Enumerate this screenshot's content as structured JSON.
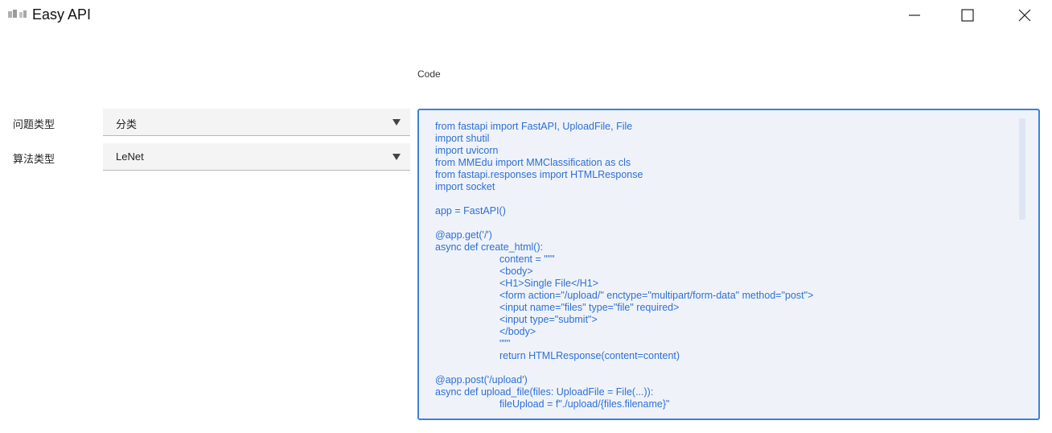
{
  "window": {
    "title": "Easy API",
    "icon": "app-logo-icon",
    "controls": [
      "minimize-icon",
      "maximize-icon",
      "close-icon"
    ]
  },
  "code_label": "Code",
  "form": {
    "problem_type": {
      "label": "问题类型",
      "value": "分类"
    },
    "algorithm_type": {
      "label": "算法类型",
      "value": "LeNet"
    }
  },
  "code": {
    "lines": [
      {
        "text": "from fastapi import FastAPI, UploadFile, File",
        "indent": false
      },
      {
        "text": "import shutil",
        "indent": false
      },
      {
        "text": "import uvicorn",
        "indent": false
      },
      {
        "text": "from MMEdu import MMClassification as cls",
        "indent": false
      },
      {
        "text": "from fastapi.responses import HTMLResponse",
        "indent": false
      },
      {
        "text": "import socket",
        "indent": false
      },
      {
        "text": "",
        "indent": false
      },
      {
        "text": "app = FastAPI()",
        "indent": false
      },
      {
        "text": "",
        "indent": false
      },
      {
        "text": "@app.get('/')",
        "indent": false
      },
      {
        "text": "async def create_html():",
        "indent": false
      },
      {
        "text": "content = \"\"\"",
        "indent": true
      },
      {
        "text": "<body>",
        "indent": true
      },
      {
        "text": "<H1>Single File</H1>",
        "indent": true
      },
      {
        "text": "<form action=\"/upload/\" enctype=\"multipart/form-data\" method=\"post\">",
        "indent": true
      },
      {
        "text": "<input name=\"files\" type=\"file\" required>",
        "indent": true
      },
      {
        "text": "<input type=\"submit\">",
        "indent": true
      },
      {
        "text": "</body>",
        "indent": true
      },
      {
        "text": "\"\"\"",
        "indent": true
      },
      {
        "text": "return HTMLResponse(content=content)",
        "indent": true
      },
      {
        "text": "",
        "indent": false
      },
      {
        "text": "@app.post('/upload')",
        "indent": false
      },
      {
        "text": "async def upload_file(files: UploadFile = File(...)):",
        "indent": false
      },
      {
        "text": "fileUpload = f\"./upload/{files.filename}\"",
        "indent": true
      }
    ]
  },
  "colors": {
    "accent_border": "#3b82d9",
    "code_text": "#2e6fd6",
    "code_background": "#eff3f9",
    "select_background": "#f4f4f4"
  }
}
